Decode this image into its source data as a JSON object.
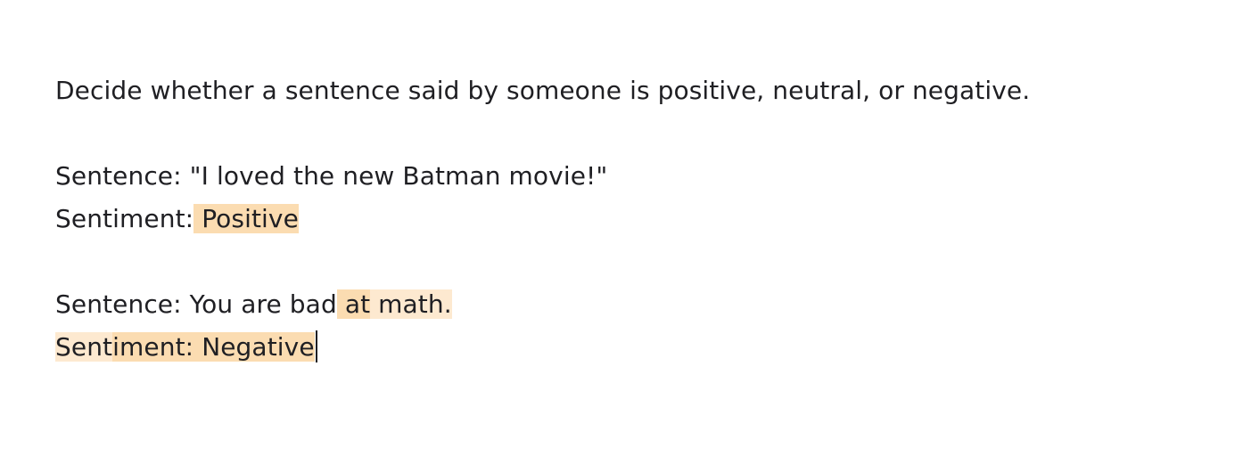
{
  "editor": {
    "instruction": "Decide whether a sentence said by someone is positive, neutral, or negative.",
    "example1": {
      "sentence_prefix": "Sentence: ",
      "sentence_text": "\"I loved the new Batman movie!\"",
      "sentiment_prefix": "Sentiment:",
      "sentiment_value": " Positive"
    },
    "example2": {
      "sentence_prefix": "Sentence: You are bad",
      "token_at": " at",
      "token_math": " math.",
      "sentiment_part1": "Sent",
      "sentiment_part2": "iment:",
      "sentiment_value": " Negative"
    }
  },
  "colors": {
    "highlight_strong": "#f9d29e",
    "highlight_light": "#fde9d0",
    "text": "#1f1f23"
  }
}
